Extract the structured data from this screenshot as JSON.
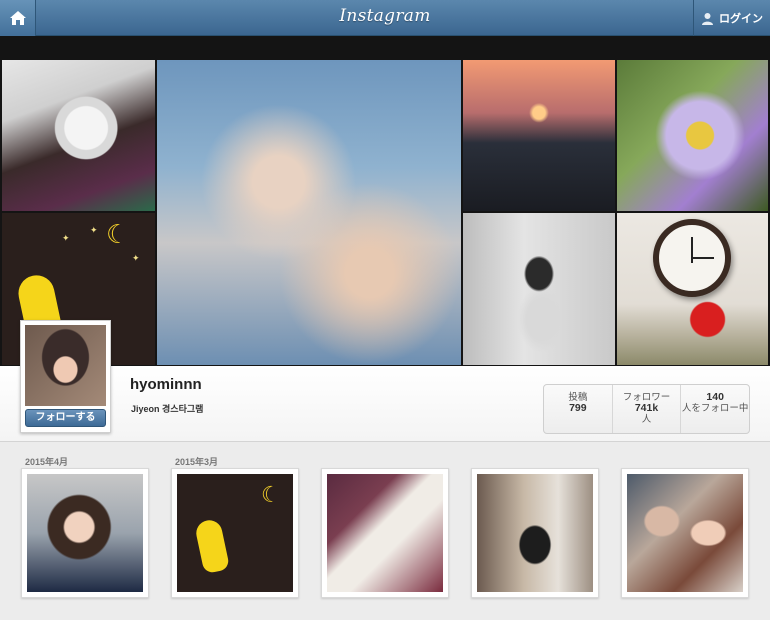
{
  "topbar": {
    "logo": "Instagram",
    "login_label": "ログイン",
    "home_icon": "home-icon",
    "user_icon": "user-icon"
  },
  "profile": {
    "username": "hyominnn",
    "fullname": "Jiyeon 경스타그램",
    "follow_label": "フォローする",
    "stats": [
      {
        "label": "投稿",
        "value": "799"
      },
      {
        "label": "フォロワー",
        "value": "741k",
        "suffix": "人"
      },
      {
        "label": "人をフォロー中",
        "value": "140"
      }
    ]
  },
  "posts": {
    "months": [
      "2015年4月",
      "2015年3月"
    ]
  },
  "colors": {
    "topbar": "#3b6690",
    "follow_button": "#3d6a96",
    "background": "#ececec"
  }
}
